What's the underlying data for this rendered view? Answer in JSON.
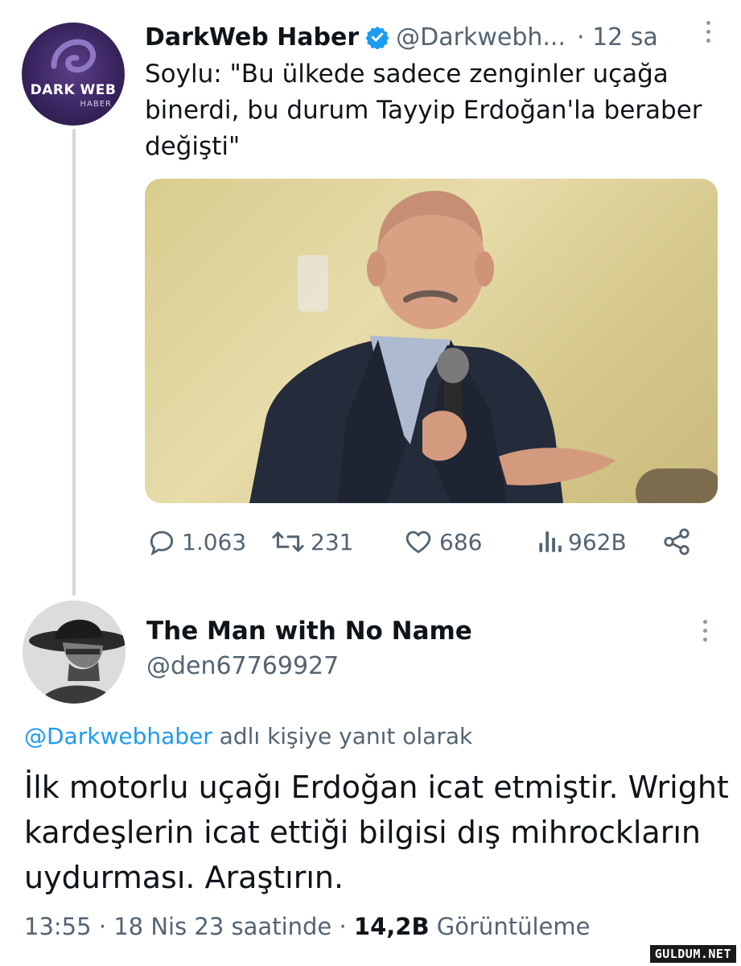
{
  "tweet": {
    "author": {
      "name": "DarkWeb Haber",
      "handle": "@Darkwebh...",
      "time": "· 12 sa",
      "avatar_text_main": "DARK WEB",
      "avatar_text_sub": "HABER"
    },
    "text": "Soylu: \"Bu ülkede sadece zenginler uçağa binerdi, bu durum Tayyip Erdoğan'la beraber değişti\"",
    "photo_icon": "photo-portrait",
    "actions": {
      "replies": "1.063",
      "retweets": "231",
      "likes": "686",
      "views": "962B"
    }
  },
  "reply": {
    "author": {
      "name": "The Man with No Name",
      "handle": "@den67769927"
    },
    "reply_to_link": "@Darkwebhaber",
    "reply_to_suffix": "adlı kişiye yanıt olarak",
    "text": "İlk motorlu uçağı Erdoğan icat etmiştir. Wright kardeşlerin icat ettiği bilgisi dış mihrockların uydurması. Araştırın.",
    "time": "13:55 · 18 Nis 23 saatinde ·",
    "views_count": "14,2B",
    "views_label": "Görüntüleme"
  },
  "watermark": "GULDUM.NET",
  "colors": {
    "text": "#0f1419",
    "secondary": "#536471",
    "link": "#1d9bf0",
    "verified": "#1d9bf0",
    "thread_line": "#cfd9de"
  }
}
